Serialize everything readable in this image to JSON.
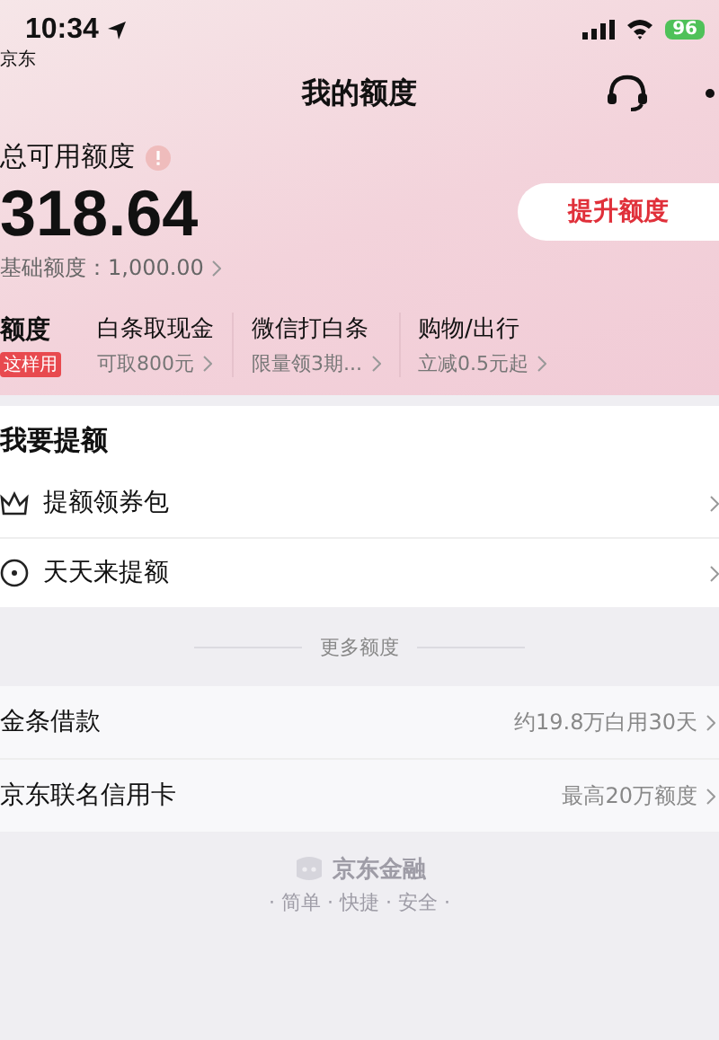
{
  "status_bar": {
    "time": "10:34",
    "back_app": "京东",
    "battery": "96"
  },
  "header": {
    "title": "我的额度"
  },
  "summary": {
    "label": "总可用额度",
    "amount": "318.64",
    "base": "基础额度：1,000.00",
    "action": "提升额度"
  },
  "tabs": [
    {
      "title": "额度",
      "badge": "这样用",
      "selected": true
    },
    {
      "title": "白条取现金",
      "subtitle": "可取800元",
      "selected": false
    },
    {
      "title": "微信打白条",
      "subtitle": "限量领3期...",
      "selected": false
    },
    {
      "title": "购物/出行",
      "subtitle": "立减0.5元起",
      "selected": false
    }
  ],
  "raise_section": {
    "title": "我要提额",
    "items": [
      {
        "label": "提额领券包",
        "kind": "crown"
      },
      {
        "label": "天天来提额",
        "kind": "target"
      }
    ]
  },
  "more_section": {
    "title": "更多额度",
    "items": [
      {
        "label": "金条借款",
        "note": "约19.8万白用30天"
      },
      {
        "label": "京东联名信用卡",
        "note": "最高20万额度"
      }
    ]
  },
  "footer": {
    "brand": "京东金融",
    "slogan": "· 简单 · 快捷 · 安全 ·"
  }
}
